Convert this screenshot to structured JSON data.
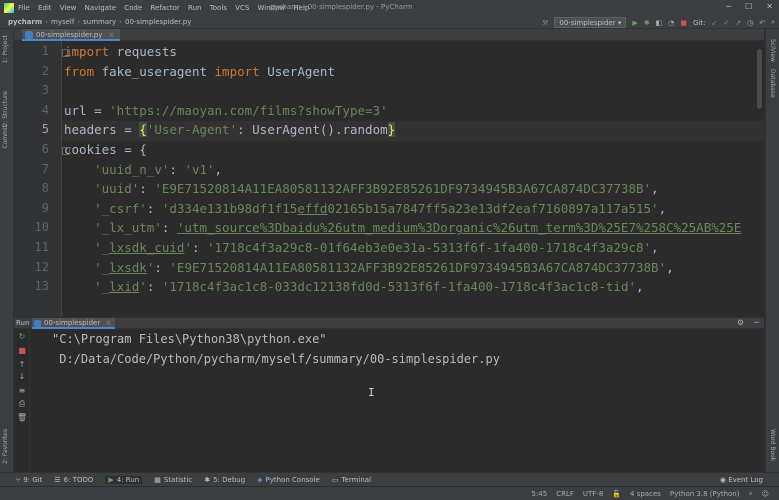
{
  "window": {
    "title": "pycharm - 00-simplespider.py - PyCharm",
    "menu": [
      "File",
      "Edit",
      "View",
      "Navigate",
      "Code",
      "Refactor",
      "Run",
      "Tools",
      "VCS",
      "Window",
      "Help"
    ]
  },
  "nav": {
    "breadcrumb": [
      "pycharm",
      "myself",
      "summary",
      "00-simplespider.py"
    ],
    "run_config": "00-simplespider",
    "git_label": "Git:"
  },
  "editor": {
    "tab_label": "00-simplespider.py",
    "current_line": 5,
    "lines": [
      {
        "n": "1",
        "segs": [
          {
            "t": "import",
            "c": "kw"
          },
          {
            "t": " requests"
          }
        ]
      },
      {
        "n": "2",
        "segs": [
          {
            "t": "from",
            "c": "kw"
          },
          {
            "t": " fake_useragent "
          },
          {
            "t": "import",
            "c": "kw"
          },
          {
            "t": " UserAgent"
          }
        ]
      },
      {
        "n": "3",
        "segs": []
      },
      {
        "n": "4",
        "segs": [
          {
            "t": "url = "
          },
          {
            "t": "'https://maoyan.com/films?showType=3'",
            "c": "str"
          }
        ]
      },
      {
        "n": "5",
        "segs": [
          {
            "t": "headers = "
          },
          {
            "t": "{",
            "c": "brk"
          },
          {
            "t": "'User-Agent'",
            "c": "str"
          },
          {
            "t": ": UserAgent().random"
          },
          {
            "t": "}",
            "c": "brk"
          }
        ]
      },
      {
        "n": "6",
        "segs": [
          {
            "t": "cookies = {"
          }
        ]
      },
      {
        "n": "7",
        "segs": [
          {
            "t": "    "
          },
          {
            "t": "'uuid_n_v'",
            "c": "str"
          },
          {
            "t": ": "
          },
          {
            "t": "'v1'",
            "c": "str"
          },
          {
            "t": ","
          }
        ]
      },
      {
        "n": "8",
        "segs": [
          {
            "t": "    "
          },
          {
            "t": "'uuid'",
            "c": "str"
          },
          {
            "t": ": "
          },
          {
            "t": "'E9E71520814A11EA80581132AFF3B92E85261DF9734945B3A67CA874DC37738B'",
            "c": "str"
          },
          {
            "t": ","
          }
        ]
      },
      {
        "n": "9",
        "segs": [
          {
            "t": "    "
          },
          {
            "t": "'_csrf'",
            "c": "str"
          },
          {
            "t": ": "
          },
          {
            "t": "'d334e131b98df1f15",
            "c": "str"
          },
          {
            "t": "effd",
            "c": "str ul"
          },
          {
            "t": "02165b15a7847ff5a23e13df2eaf7160897a117a515'",
            "c": "str"
          },
          {
            "t": ","
          }
        ]
      },
      {
        "n": "10",
        "segs": [
          {
            "t": "    "
          },
          {
            "t": "'_lx_utm'",
            "c": "str"
          },
          {
            "t": ": "
          },
          {
            "t": "'utm_source%3Dbaidu%26utm_medium%3Dorganic%26utm_term%3D%25E7%258C%25AB%25E",
            "c": "str ul"
          }
        ]
      },
      {
        "n": "11",
        "segs": [
          {
            "t": "    "
          },
          {
            "t": "'_",
            "c": "str"
          },
          {
            "t": "lxsdk_cuid",
            "c": "str ul"
          },
          {
            "t": "'",
            "c": "str"
          },
          {
            "t": ": "
          },
          {
            "t": "'1718c4f3a29c8-01f64eb3e0e31a-5313f6f-1fa400-1718c4f3a29c8'",
            "c": "str"
          },
          {
            "t": ","
          }
        ]
      },
      {
        "n": "12",
        "segs": [
          {
            "t": "    "
          },
          {
            "t": "'_",
            "c": "str"
          },
          {
            "t": "lxsdk",
            "c": "str ul"
          },
          {
            "t": "'",
            "c": "str"
          },
          {
            "t": ": "
          },
          {
            "t": "'E9E71520814A11EA80581132AFF3B92E85261DF9734945B3A67CA874DC37738B'",
            "c": "str"
          },
          {
            "t": ","
          }
        ]
      },
      {
        "n": "13",
        "segs": [
          {
            "t": "    "
          },
          {
            "t": "'_",
            "c": "str"
          },
          {
            "t": "lxid",
            "c": "str ul"
          },
          {
            "t": "'",
            "c": "str"
          },
          {
            "t": ": "
          },
          {
            "t": "'1718c4f3ac1c8-033dc12138fd0d-5313f6f-1fa400-1718c4f3ac1c8-tid'",
            "c": "str"
          },
          {
            "t": ","
          }
        ]
      }
    ]
  },
  "run_panel": {
    "label": "Run",
    "tab_label": "00-simplespider",
    "console_lines": [
      "\"C:\\Program Files\\Python38\\python.exe\"",
      " D:/Data/Code/Python/pycharm/myself/summary/00-simplespider.py"
    ]
  },
  "side_tools": {
    "left": [
      "1: Project",
      "2: Structure",
      "Commit"
    ],
    "left_bottom": "2: Favorites",
    "right": [
      "SciView",
      "Database"
    ],
    "right_bottom": "Word Book"
  },
  "bottom_tools": {
    "items": [
      {
        "label": "9: Git",
        "icon": "git-branch-icon"
      },
      {
        "label": "6: TODO",
        "icon": "list-icon"
      },
      {
        "label": "4: Run",
        "icon": "run-icon",
        "active": true
      },
      {
        "label": "Statistic",
        "icon": "stats-icon"
      },
      {
        "label": "5: Debug",
        "icon": "bug-icon"
      },
      {
        "label": "Python Console",
        "icon": "python-icon"
      },
      {
        "label": "Terminal",
        "icon": "terminal-icon"
      }
    ],
    "event_log": "Event Log"
  },
  "status": {
    "position": "5:45",
    "line_sep": "CRLF",
    "encoding": "UTF-8",
    "indent": "4 spaces",
    "interpreter": "Python 3.8 (Python)"
  },
  "colors": {
    "keyword": "#cc7832",
    "string": "#6a8759",
    "default_text": "#a9b7c6",
    "background": "#2b2b2b",
    "chrome": "#3c3f41",
    "accent": "#4a88c7"
  }
}
